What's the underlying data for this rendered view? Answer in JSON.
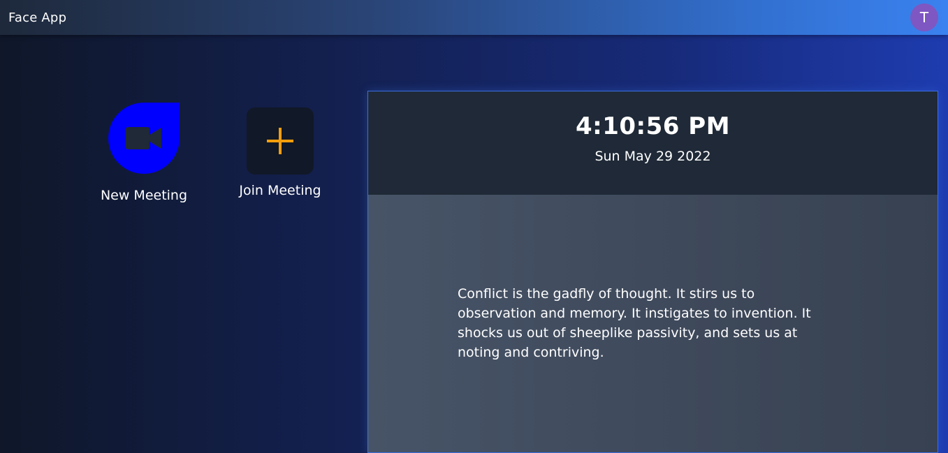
{
  "header": {
    "app_title": "Face App",
    "avatar_initial": "T",
    "avatar_color": "#7e57c2"
  },
  "actions": {
    "new_meeting": {
      "label": "New Meeting",
      "icon": "video-camera-icon",
      "color": "#0000ff"
    },
    "join_meeting": {
      "label": "Join Meeting",
      "icon": "plus-icon",
      "color": "#f59e0b"
    }
  },
  "clock": {
    "time": "4:10:56 PM",
    "date": "Sun May 29 2022"
  },
  "quote": {
    "text": "Conflict is the gadfly of thought. It stirs us to observation and memory. It instigates to invention. It shocks us out of sheeplike passivity, and sets us at noting and contriving."
  }
}
